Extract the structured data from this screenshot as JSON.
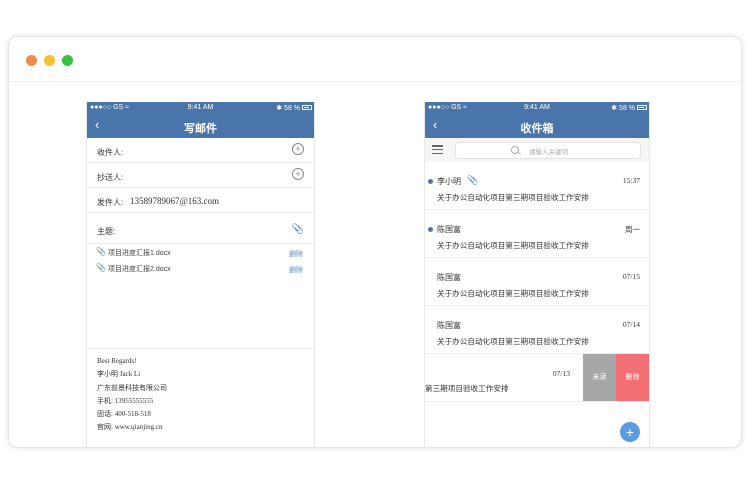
{
  "window": {
    "dot_colors": [
      "#f08a4b",
      "#f5c12e",
      "#33c13f"
    ]
  },
  "compose": {
    "status": {
      "left": "●●●○○ GS ≈",
      "time": "9:41 AM",
      "right": "✱ 58 %"
    },
    "nav": {
      "back_icon": "chevron-left-icon",
      "title": "写邮件"
    },
    "to_label": "收件人:",
    "cc_label": "抄送人:",
    "from_label": "发件人:",
    "from_value": "13589789067@163.com",
    "subject_label": "主题:",
    "attachments": [
      {
        "name": "项目进度汇报1.docx",
        "delete": "删除"
      },
      {
        "name": "项目进度汇报2.docx",
        "delete": "删除"
      }
    ],
    "signature": [
      "Best Regards!",
      "李小明  Jack Li",
      "广东前景科技有限公司",
      "手机:  13955555555",
      "固话:   400-518-518",
      "官网:  www.qianjing.cn"
    ]
  },
  "inbox": {
    "status": {
      "left": "●●●○○ GS ≈",
      "time": "9:41 AM",
      "right": "✱ 58 %"
    },
    "nav": {
      "back_icon": "chevron-left-icon",
      "title": "收件箱"
    },
    "search_placeholder": "请输入关键词",
    "mails": [
      {
        "sender": "李小明",
        "time": "15:37",
        "subject": "关于办公自动化项目第三期项目验收工作安排",
        "unread": true,
        "attachment": true
      },
      {
        "sender": "陈国富",
        "time": "周一",
        "subject": "关于办公自动化项目第三期项目验收工作安排",
        "unread": true,
        "attachment": false
      },
      {
        "sender": "陈国富",
        "time": "07/15",
        "subject": "关于办公自动化项目第三期项目验收工作安排",
        "unread": false,
        "attachment": false
      },
      {
        "sender": "陈国富",
        "time": "07/14",
        "subject": "关于办公自动化项目第三期项目验收工作安排",
        "unread": false,
        "attachment": false
      }
    ],
    "swiped_mail": {
      "time": "07/13",
      "subject": "第三期项目验收工作安排",
      "mark_label": "未读",
      "delete_label": "删除"
    },
    "fab_label": "+",
    "accent": "#4a75aa",
    "delete_color": "#f46f71"
  }
}
